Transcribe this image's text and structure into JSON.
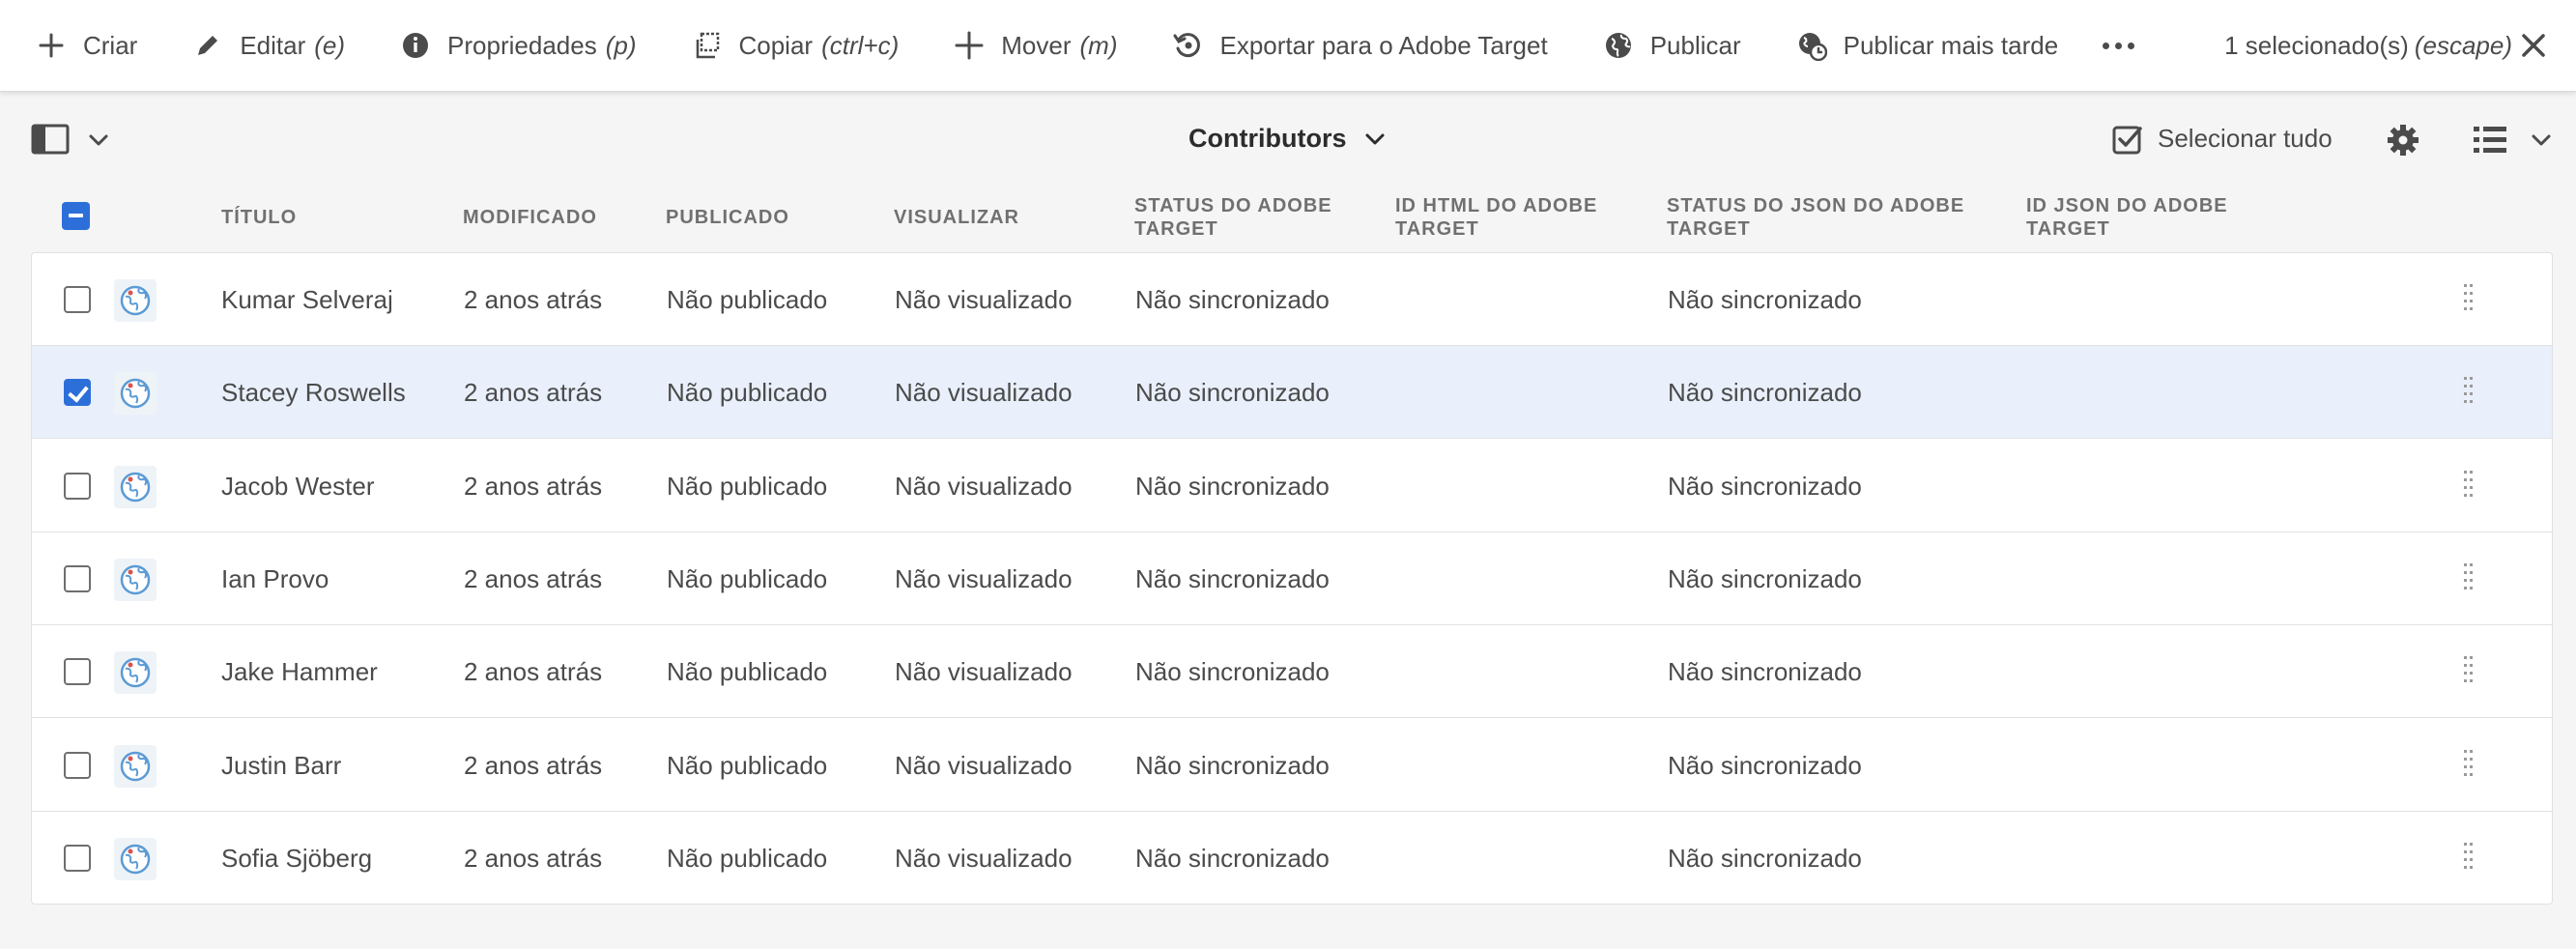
{
  "actionbar": {
    "actions": [
      {
        "label": "Criar",
        "hint": "",
        "icon": "add-icon"
      },
      {
        "label": "Editar",
        "hint": "(e)",
        "icon": "edit-icon"
      },
      {
        "label": "Propriedades",
        "hint": "(p)",
        "icon": "info-icon"
      },
      {
        "label": "Copiar",
        "hint": "(ctrl+c)",
        "icon": "copy-icon"
      },
      {
        "label": "Mover",
        "hint": "(m)",
        "icon": "move-icon"
      },
      {
        "label": "Exportar para o Adobe Target",
        "hint": "",
        "icon": "export-target-icon"
      },
      {
        "label": "Publicar",
        "hint": "",
        "icon": "globe-icon"
      },
      {
        "label": "Publicar mais tarde",
        "hint": "",
        "icon": "globe-clock-icon"
      }
    ],
    "selection_text": "1 selecionado(s)",
    "selection_hint": "(escape)"
  },
  "toolbar": {
    "collection_title": "Contributors",
    "select_all_label": "Selecionar tudo"
  },
  "table": {
    "columns": [
      "TÍTULO",
      "MODIFICADO",
      "PUBLICADO",
      "VISUALIZAR",
      "STATUS DO ADOBE TARGET",
      "ID HTML DO ADOBE TARGET",
      "STATUS DO JSON DO ADOBE TARGET",
      "ID JSON DO ADOBE TARGET"
    ],
    "rows": [
      {
        "title": "Kumar Selveraj",
        "modified": "2 anos atrás",
        "published": "Não publicado",
        "preview": "Não visualizado",
        "target_status": "Não sincronizado",
        "target_html_id": "",
        "target_json_status": "Não sincronizado",
        "target_json_id": "",
        "selected": false
      },
      {
        "title": "Stacey Roswells",
        "modified": "2 anos atrás",
        "published": "Não publicado",
        "preview": "Não visualizado",
        "target_status": "Não sincronizado",
        "target_html_id": "",
        "target_json_status": "Não sincronizado",
        "target_json_id": "",
        "selected": true
      },
      {
        "title": "Jacob Wester",
        "modified": "2 anos atrás",
        "published": "Não publicado",
        "preview": "Não visualizado",
        "target_status": "Não sincronizado",
        "target_html_id": "",
        "target_json_status": "Não sincronizado",
        "target_json_id": "",
        "selected": false
      },
      {
        "title": "Ian Provo",
        "modified": "2 anos atrás",
        "published": "Não publicado",
        "preview": "Não visualizado",
        "target_status": "Não sincronizado",
        "target_html_id": "",
        "target_json_status": "Não sincronizado",
        "target_json_id": "",
        "selected": false
      },
      {
        "title": "Jake Hammer",
        "modified": "2 anos atrás",
        "published": "Não publicado",
        "preview": "Não visualizado",
        "target_status": "Não sincronizado",
        "target_html_id": "",
        "target_json_status": "Não sincronizado",
        "target_json_id": "",
        "selected": false
      },
      {
        "title": "Justin Barr",
        "modified": "2 anos atrás",
        "published": "Não publicado",
        "preview": "Não visualizado",
        "target_status": "Não sincronizado",
        "target_html_id": "",
        "target_json_status": "Não sincronizado",
        "target_json_id": "",
        "selected": false
      },
      {
        "title": "Sofia Sjöberg",
        "modified": "2 anos atrás",
        "published": "Não publicado",
        "preview": "Não visualizado",
        "target_status": "Não sincronizado",
        "target_html_id": "",
        "target_json_status": "Não sincronizado",
        "target_json_id": "",
        "selected": false
      }
    ]
  },
  "colors": {
    "accent": "#2d6fd9",
    "selected_row": "#e9f0fb",
    "text": "#4b4b4b"
  }
}
